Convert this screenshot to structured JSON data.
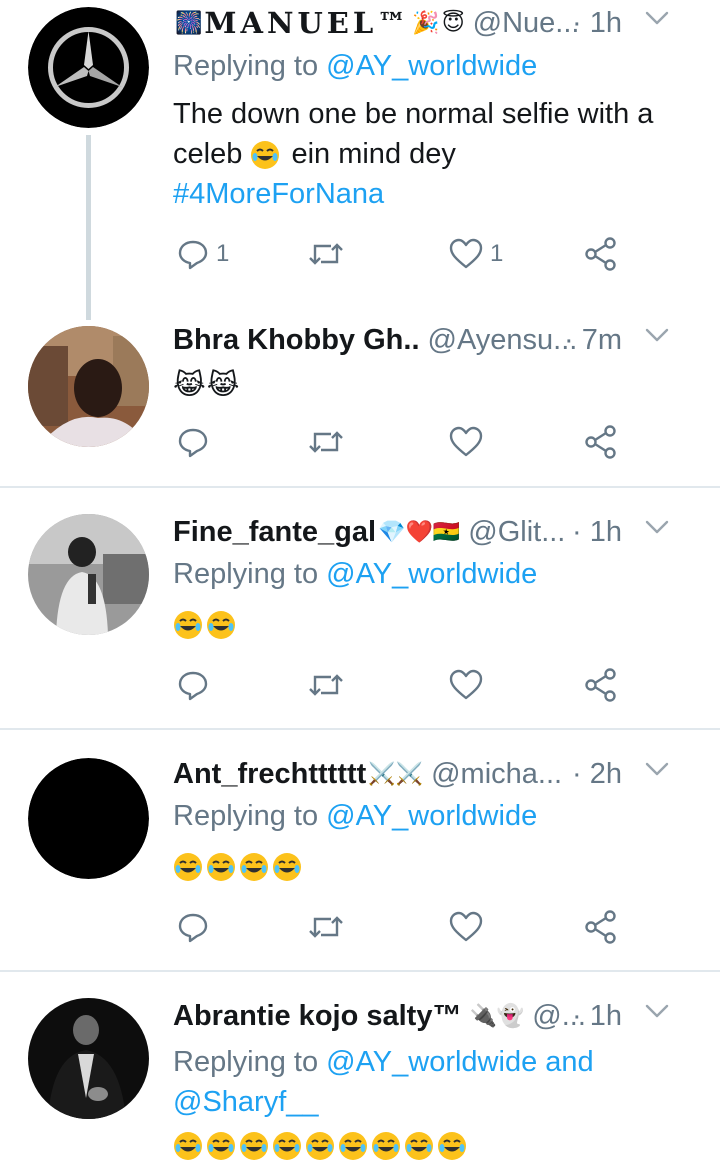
{
  "tweets": [
    {
      "name": "MANUEL™",
      "handle": "@Nue...",
      "sep_time": "· 1h",
      "reply_prefix": "Replying to ",
      "reply_to": "@AY_worldwide",
      "text": "The down one be normal selfie with a celeb",
      "text_after": "ein mind dey",
      "hashtag": "#4MoreForNana",
      "reply_count": "1",
      "like_count": "1"
    },
    {
      "name": "Bhra Khobby Gh..",
      "handle": "@Ayensu...",
      "sep_time": "· 7m",
      "emoji": "😹😹"
    },
    {
      "name": "Fine_fante_gal",
      "name_badges": "💎❤️🇬🇭",
      "handle": "@Glit...",
      "sep_time": "· 1h",
      "reply_prefix": "Replying to ",
      "reply_to": "@AY_worldwide",
      "emoji_count": 2
    },
    {
      "name": "Ant_frechtttttt",
      "name_badges": "⚔️⚔️",
      "handle": "@micha...",
      "sep_time": "· 2h",
      "reply_prefix": "Replying to ",
      "reply_to": "@AY_worldwide",
      "emoji_count": 4
    },
    {
      "name": "Abrantie kojo salty™",
      "name_badges": "🔌👻",
      "handle": "@...",
      "sep_time": "· 1h",
      "reply_prefix": "Replying to ",
      "reply_to": "@AY_worldwide and",
      "reply_to_2": "@Sharyf__",
      "emoji_count": 9
    }
  ],
  "icons": {
    "reply": "reply-icon",
    "retweet": "retweet-icon",
    "like": "heart-icon",
    "share": "share-icon",
    "more": "chevron-down-icon"
  },
  "colors": {
    "link": "#1da1f2",
    "secondary": "#657786",
    "text": "#14171a",
    "divider": "#e1e8ed"
  }
}
